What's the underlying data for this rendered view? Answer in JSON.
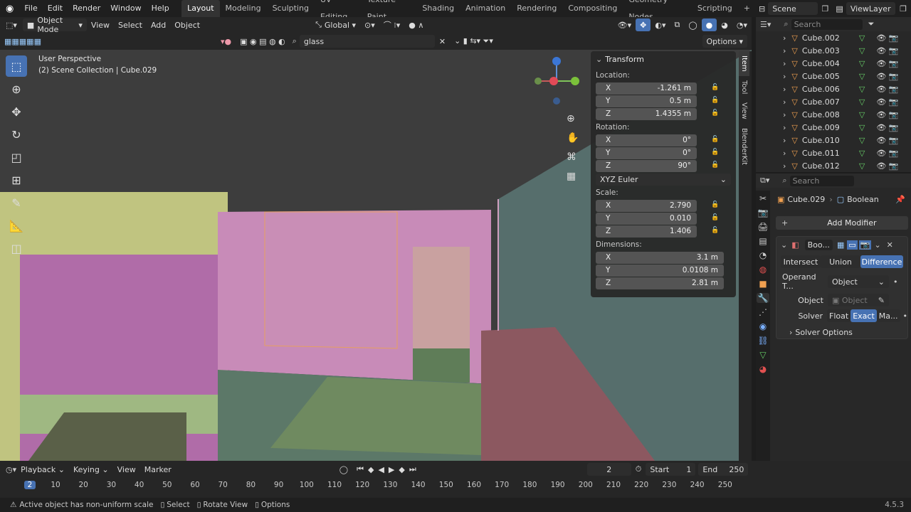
{
  "topbar": {
    "menus": [
      "File",
      "Edit",
      "Render",
      "Window",
      "Help"
    ],
    "workspaces": [
      "Layout",
      "Modeling",
      "Sculpting",
      "UV Editing",
      "Texture Paint",
      "Shading",
      "Animation",
      "Rendering",
      "Compositing",
      "Geometry Nodes",
      "Scripting"
    ],
    "active_workspace": "Layout",
    "add_tab": "+",
    "scene": "Scene",
    "view_layer": "ViewLayer"
  },
  "viewport_header": {
    "mode": "Object Mode",
    "menus": [
      "View",
      "Select",
      "Add",
      "Object"
    ],
    "orientation": "Global",
    "search_value": "glass",
    "options": "Options"
  },
  "viewport": {
    "perspective": "User Perspective",
    "collection": "(2) Scene Collection | Cube.029"
  },
  "npanel": {
    "title": "Transform",
    "location_label": "Location:",
    "location": [
      {
        "axis": "X",
        "value": "-1.261 m"
      },
      {
        "axis": "Y",
        "value": "0.5 m"
      },
      {
        "axis": "Z",
        "value": "1.4355 m"
      }
    ],
    "rotation_label": "Rotation:",
    "rotation": [
      {
        "axis": "X",
        "value": "0°"
      },
      {
        "axis": "Y",
        "value": "0°"
      },
      {
        "axis": "Z",
        "value": "90°"
      }
    ],
    "rotation_mode": "XYZ Euler",
    "scale_label": "Scale:",
    "scale": [
      {
        "axis": "X",
        "value": "2.790"
      },
      {
        "axis": "Y",
        "value": "0.010"
      },
      {
        "axis": "Z",
        "value": "1.406"
      }
    ],
    "dimensions_label": "Dimensions:",
    "dimensions": [
      {
        "axis": "X",
        "value": "3.1 m"
      },
      {
        "axis": "Y",
        "value": "0.0108 m"
      },
      {
        "axis": "Z",
        "value": "2.81 m"
      }
    ],
    "tabs": [
      "Item",
      "Tool",
      "View",
      "BlenderKit"
    ]
  },
  "outliner": {
    "search_placeholder": "Search",
    "items": [
      "Cube.002",
      "Cube.003",
      "Cube.004",
      "Cube.005",
      "Cube.006",
      "Cube.007",
      "Cube.008",
      "Cube.009",
      "Cube.010",
      "Cube.011",
      "Cube.012"
    ]
  },
  "properties": {
    "search_placeholder": "Search",
    "object_name": "Cube.029",
    "modifier_name": "Boolean",
    "add_modifier": "Add Modifier",
    "modifier_short": "Boo...",
    "operations": [
      "Intersect",
      "Union",
      "Difference"
    ],
    "active_operation": "Difference",
    "operand_label": "Operand T...",
    "operand_value": "Object",
    "object_label": "Object",
    "object_placeholder": "Object",
    "solver_label": "Solver",
    "solvers": [
      "Float",
      "Exact",
      "Ma..."
    ],
    "active_solver": "Exact",
    "solver_options": "Solver Options"
  },
  "timeline": {
    "menus": [
      "Playback",
      "Keying",
      "View",
      "Marker"
    ],
    "current_frame": "2",
    "start_label": "Start",
    "start": "1",
    "end_label": "End",
    "end": "250",
    "ticks": [
      "2",
      "10",
      "20",
      "30",
      "40",
      "50",
      "60",
      "70",
      "80",
      "90",
      "100",
      "110",
      "120",
      "130",
      "140",
      "150",
      "160",
      "170",
      "180",
      "190",
      "200",
      "210",
      "220",
      "230",
      "240",
      "250"
    ]
  },
  "statusbar": {
    "message": "Active object has non-uniform scale",
    "select": "Select",
    "rotate_view": "Rotate View",
    "options": "Options",
    "version": "4.5.3"
  }
}
